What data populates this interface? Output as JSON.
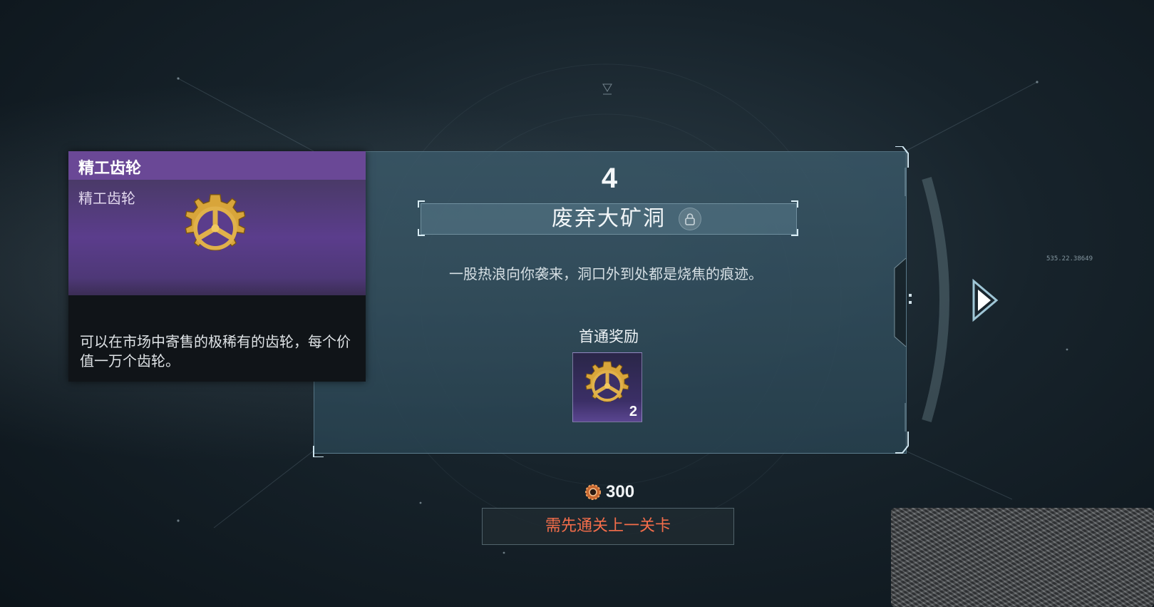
{
  "level": {
    "number": "4",
    "name": "废弃大矿洞",
    "description": "一股热浪向你袭来，洞口外到处都是烧焦的痕迹。",
    "locked": true
  },
  "reward": {
    "label": "首通奖励",
    "item_icon": "gear-icon",
    "count": "2"
  },
  "tooltip": {
    "title": "精工齿轮",
    "subtitle": "精工齿轮",
    "description": "可以在市场中寄售的极稀有的齿轮，每个价值一万个齿轮。",
    "colors": {
      "header": "#6a4896",
      "art": "#5b3d8c"
    }
  },
  "cost": {
    "icon": "gear-coin-icon",
    "value": "300"
  },
  "action_button": {
    "label": "需先通关上一关卡",
    "color": "#f36d4a"
  },
  "hud": {
    "readout": "535.22.38649"
  },
  "icons": {
    "next": "next-arrow-icon",
    "lock": "lock-icon"
  }
}
